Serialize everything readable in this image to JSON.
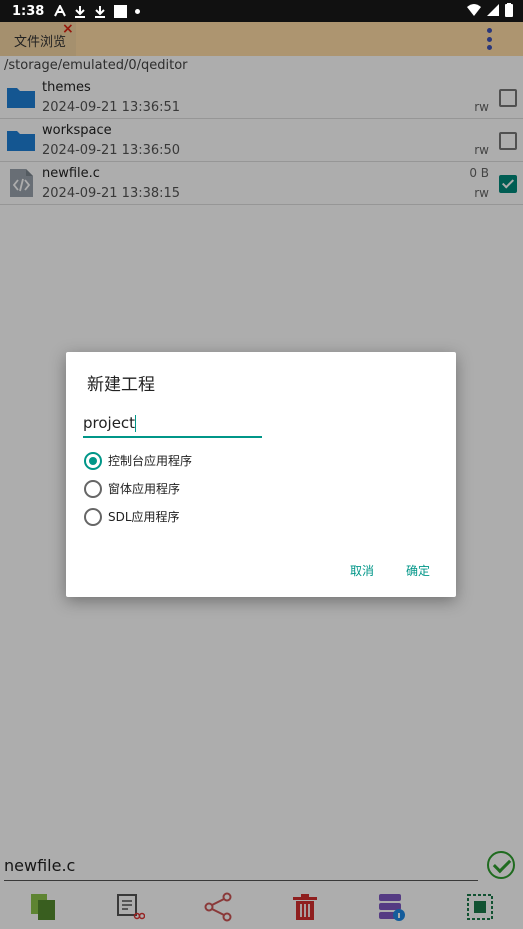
{
  "status": {
    "time": "1:38"
  },
  "tab": {
    "label": "文件浏览",
    "close": "×"
  },
  "path": "/storage/emulated/0/qeditor",
  "files": [
    {
      "name": "themes",
      "date": "2024-09-21 13:36:51",
      "size": "",
      "perm": "rw",
      "type": "folder",
      "checked": false
    },
    {
      "name": "workspace",
      "date": "2024-09-21 13:36:50",
      "size": "",
      "perm": "rw",
      "type": "folder",
      "checked": false
    },
    {
      "name": "newfile.c",
      "date": "2024-09-21 13:38:15",
      "size": "0 B",
      "perm": "rw",
      "type": "code",
      "checked": true
    }
  ],
  "bottom": {
    "filename": "newfile.c"
  },
  "dialog": {
    "title": "新建工程",
    "input_value": "project",
    "options": [
      "控制台应用程序",
      "窗体应用程序",
      "SDL应用程序"
    ],
    "selected_index": 0,
    "cancel": "取消",
    "confirm": "确定"
  },
  "colors": {
    "accent": "#009688",
    "tabbar": "#ffdca6",
    "folder": "#1e7fd6"
  }
}
